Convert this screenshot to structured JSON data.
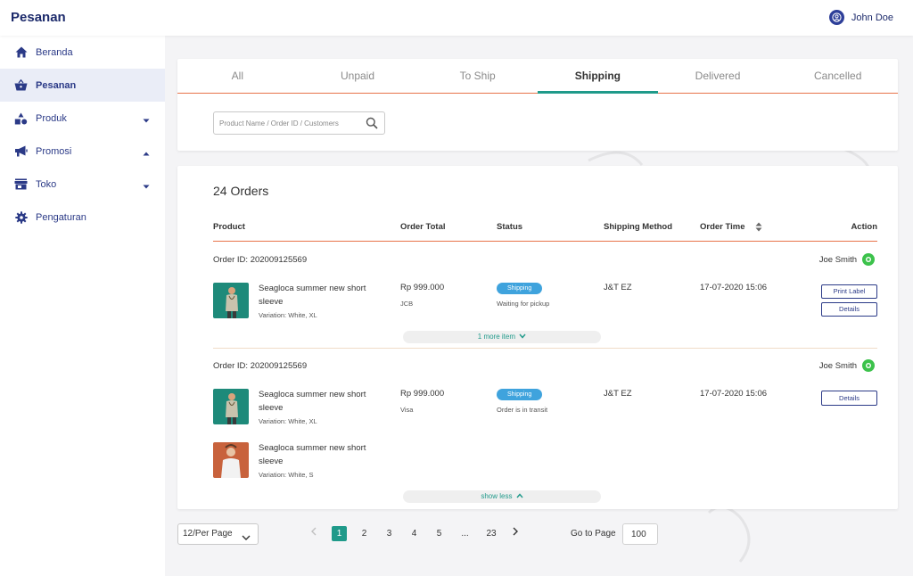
{
  "app": {
    "title": "Pesanan"
  },
  "user": {
    "name": "John Doe",
    "icon": "user-circle-icon"
  },
  "sidebar": {
    "items": [
      {
        "label": "Beranda",
        "icon": "home-icon"
      },
      {
        "label": "Pesanan",
        "icon": "basket-icon",
        "active": true
      },
      {
        "label": "Produk",
        "icon": "shapes-icon",
        "caret": "down"
      },
      {
        "label": "Promosi",
        "icon": "megaphone-icon",
        "caret": "up"
      },
      {
        "label": "Toko",
        "icon": "store-icon",
        "caret": "down"
      },
      {
        "label": "Pengaturan",
        "icon": "gear-icon"
      }
    ]
  },
  "tabs": [
    {
      "label": "All"
    },
    {
      "label": "Unpaid"
    },
    {
      "label": "To Ship"
    },
    {
      "label": "Shipping",
      "active": true
    },
    {
      "label": "Delivered"
    },
    {
      "label": "Cancelled"
    }
  ],
  "search": {
    "placeholder": "Product Name / Order ID / Customers",
    "value": ""
  },
  "orders": {
    "title": "24 Orders",
    "columns": {
      "product": "Product",
      "total": "Order Total",
      "status": "Status",
      "shipping": "Shipping Method",
      "time": "Order Time",
      "action": "Action"
    },
    "list": [
      {
        "order_id": "Order ID: 202009125569",
        "customer": "Joe Smith",
        "items": [
          {
            "name": "Seagloca summer new short sleeve",
            "variation": "Variation: White, XL"
          }
        ],
        "total": "Rp 999.000",
        "payment": "JCB",
        "status": "Shipping",
        "status_note": "Waiting for pickup",
        "shipping": "J&T EZ",
        "time": "17-07-2020 15:06",
        "actions": [
          "Print Label",
          "Details"
        ],
        "toggle": "1 more item"
      },
      {
        "order_id": "Order ID: 202009125569",
        "customer": "Joe Smith",
        "items": [
          {
            "name": "Seagloca summer new short sleeve",
            "variation": "Variation: White, XL"
          },
          {
            "name": "Seagloca summer new short sleeve",
            "variation": "Variation: White, S"
          }
        ],
        "total": "Rp 999.000",
        "payment": "Visa",
        "status": "Shipping",
        "status_note": "Order is in transit",
        "shipping": "J&T EZ",
        "time": "17-07-2020 15:06",
        "actions": [
          "Details"
        ],
        "toggle": "show less"
      }
    ]
  },
  "pagination": {
    "per_page": "12/Per Page",
    "pages": [
      "1",
      "2",
      "3",
      "4",
      "5",
      "...",
      "23"
    ],
    "current": "1",
    "goto_label": "Go to Page",
    "goto_value": "100"
  },
  "colors": {
    "brand": "#1c2a6b",
    "accent": "#1f9a8a",
    "divider": "#e8734a",
    "badge": "#3fa3dd",
    "chat": "#3cc24b"
  }
}
